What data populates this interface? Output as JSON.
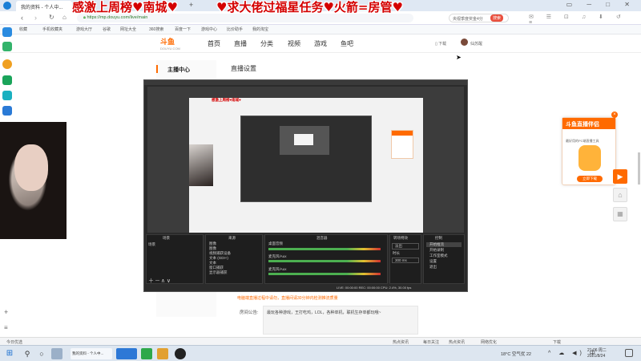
{
  "browser": {
    "tab1_title": "我的资料 - 个人中...",
    "url": "https://mp.douyu.com/live/main",
    "search_placeholder": "央视季度奖金4分",
    "search_button": "搜索"
  },
  "bookmarks": [
    "收藏",
    "手机收藏夹",
    "游戏大厅",
    "谷歌",
    "网址大全",
    "360搜索",
    "百度一下",
    "游戏中心",
    "比价助手",
    "我的淘宝"
  ],
  "overlay": {
    "line1": "感激上周榜♥南城♥",
    "line2": "♥求大佬过福星任务♥火箭=房管♥"
  },
  "site": {
    "logo_text": "斗鱼",
    "logo_sub": "DOUYU.COM",
    "nav": [
      "首页",
      "直播",
      "分类",
      "视频",
      "游戏",
      "鱼吧"
    ],
    "download_label": "下载",
    "user_name": "仙苏醒"
  },
  "sidebar": {
    "title": "主播中心",
    "section_title": "直播设置"
  },
  "obs": {
    "panels": [
      "场景",
      "来源",
      "混音器",
      "转场特效",
      "控制"
    ],
    "scene_item": "场景",
    "sources": [
      "图像",
      "图像",
      "视频捕获设备",
      "文本 (GDI+)",
      "文本",
      "窗口捕获",
      "显示器捕获"
    ],
    "mixer": [
      "桌面音频",
      "麦克风/Aux",
      "麦克风/Aux"
    ],
    "transition": "淡出",
    "duration_label": "时长",
    "duration_value": "300 ms",
    "controls": [
      "开始推流",
      "开始录制",
      "工作室模式",
      "设置",
      "退出"
    ],
    "status": "LIVE: 00:00:00  REC: 00:00:00  CPU: 2.4%, 30.00 fps"
  },
  "notice": {
    "red_text": "电脑端直播过程中请勿，直播间请30分钟内检测推流质量",
    "label": "房间公告:",
    "content": "最玩各种游戏，王打吃鸡，LOL，各种单机，联机生存单都玩哦~"
  },
  "promo": {
    "title": "斗鱼直播伴侣",
    "line": "最好用的PC端直播工具",
    "button": "立即下载"
  },
  "status_bar": {
    "left": "今日优选",
    "items": [
      "热点资讯",
      "每日关注",
      "热点资讯",
      "网络优化",
      "下载"
    ]
  },
  "taskbar": {
    "weather": "18°C 空气优 22",
    "time": "21:06 周二",
    "date": "2021/8/24"
  },
  "colors": {
    "accent": "#ff6a00",
    "overlay_red": "#d40000",
    "obs_bg": "#2b2b2b"
  }
}
